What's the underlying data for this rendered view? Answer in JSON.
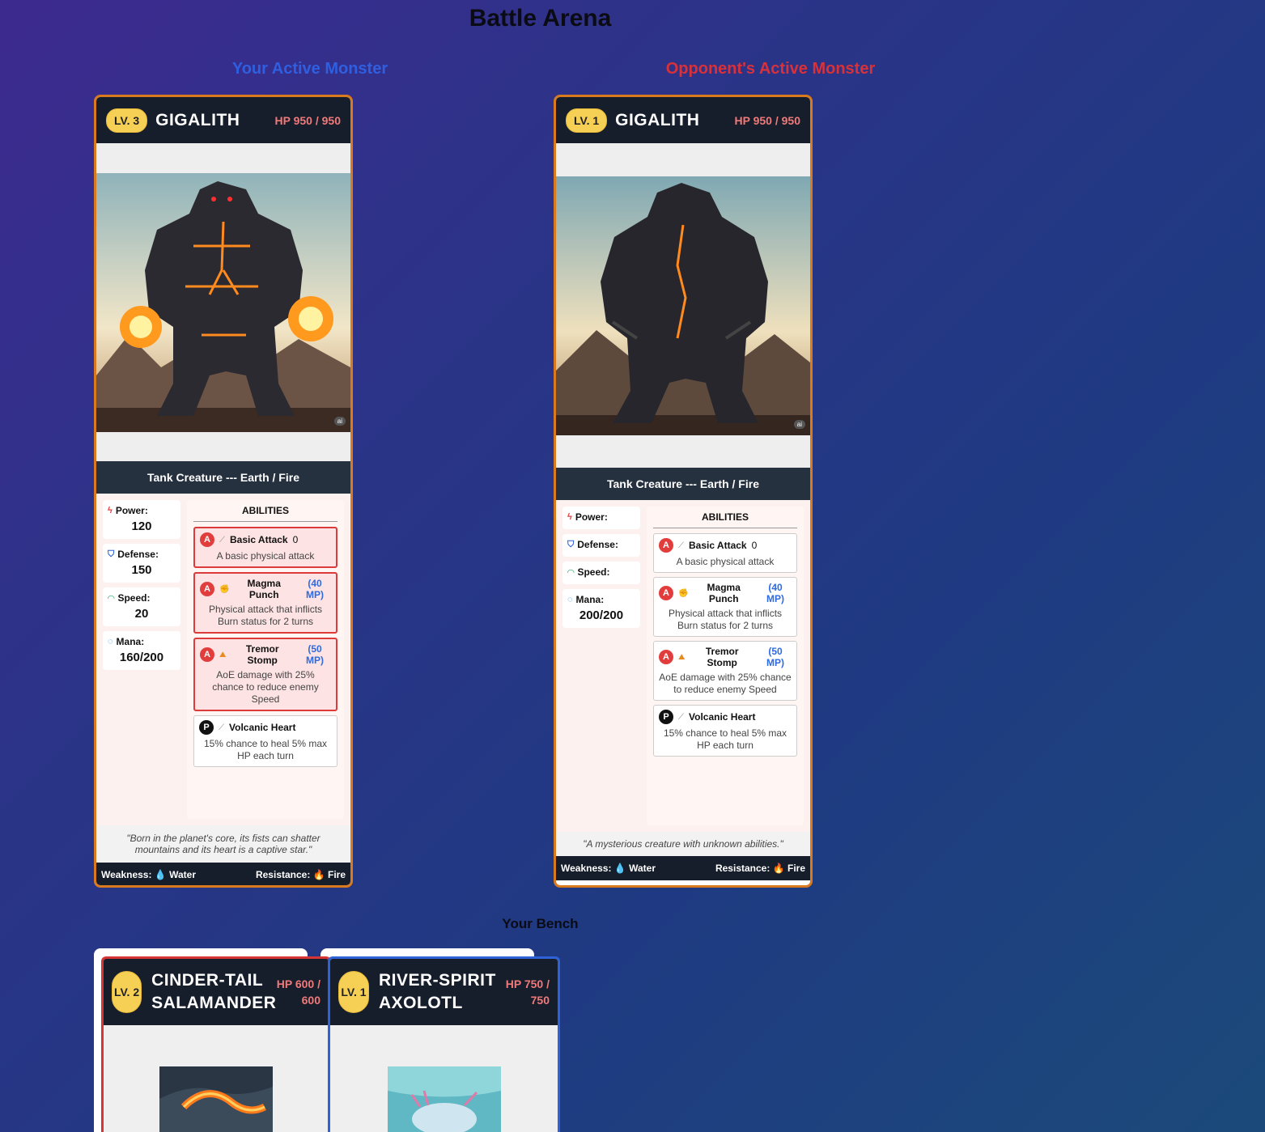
{
  "arena": {
    "title": "Battle Arena",
    "your_label": "Your Active Monster",
    "opp_label": "Opponent's Active Monster",
    "bench_label": "Your Bench"
  },
  "your_monster": {
    "level": "LV. 3",
    "name": "GIGALITH",
    "hp": "HP 950 / 950",
    "type": "Tank Creature --- Earth / Fire",
    "stats": {
      "power_label": "Power:",
      "power": "120",
      "defense_label": "Defense:",
      "defense": "150",
      "speed_label": "Speed:",
      "speed": "20",
      "mana_label": "Mana:",
      "mana": "160/200"
    },
    "abilities_title": "ABILITIES",
    "abilities": [
      {
        "badge": "A",
        "name": "Basic Attack",
        "cost": "0",
        "desc": "A basic physical attack"
      },
      {
        "badge": "A",
        "name": "Magma Punch",
        "cost": "(40 MP)",
        "desc": "Physical attack that inflicts Burn status for 2 turns"
      },
      {
        "badge": "A",
        "name": "Tremor Stomp",
        "cost": "(50 MP)",
        "desc": "AoE damage with 25% chance to reduce enemy Speed"
      },
      {
        "badge": "P",
        "name": "Volcanic Heart",
        "cost": "",
        "desc": "15% chance to heal 5% max HP each turn"
      }
    ],
    "flavor": "\"Born in the planet's core, its fists can shatter mountains and its heart is a captive star.\"",
    "weakness_label": "Weakness:",
    "weakness": "Water",
    "resistance_label": "Resistance:",
    "resistance": "Fire"
  },
  "opp_monster": {
    "level": "LV. 1",
    "name": "GIGALITH",
    "hp": "HP 950 / 950",
    "type": "Tank Creature --- Earth / Fire",
    "stats": {
      "power_label": "Power:",
      "defense_label": "Defense:",
      "speed_label": "Speed:",
      "mana_label": "Mana:",
      "mana": "200/200"
    },
    "abilities_title": "ABILITIES",
    "abilities": [
      {
        "badge": "A",
        "name": "Basic Attack",
        "cost": "0",
        "desc": "A basic physical attack"
      },
      {
        "badge": "A",
        "name": "Magma Punch",
        "cost": "(40 MP)",
        "desc": "Physical attack that inflicts Burn status for 2 turns"
      },
      {
        "badge": "A",
        "name": "Tremor Stomp",
        "cost": "(50 MP)",
        "desc": "AoE damage with 25% chance to reduce enemy Speed"
      },
      {
        "badge": "P",
        "name": "Volcanic Heart",
        "cost": "",
        "desc": "15% chance to heal 5% max HP each turn"
      }
    ],
    "flavor": "\"A mysterious creature with unknown abilities.\"",
    "weakness_label": "Weakness:",
    "weakness": "Water",
    "resistance_label": "Resistance:",
    "resistance": "Fire"
  },
  "bench": [
    {
      "level": "LV. 2",
      "name": "CINDER-TAIL SALAMANDER",
      "hp": "HP 600 / 600"
    },
    {
      "level": "LV. 1",
      "name": "RIVER-SPIRIT AXOLOTL",
      "hp": "HP 750 / 750"
    }
  ],
  "ai_badge": "ai",
  "colors": {
    "accent_orange": "#d97a1f",
    "fire_red": "#d73535",
    "water_blue": "#2f62d6",
    "level_gold": "#f6cf55"
  }
}
